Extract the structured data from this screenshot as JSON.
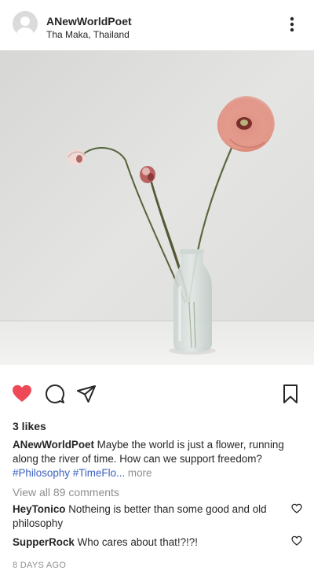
{
  "post": {
    "username": "ANewWorldPoet",
    "location": "Tha Maka, Thailand",
    "likes": "3 likes",
    "caption": {
      "author": "ANewWorldPoet",
      "text": "Maybe the world is just a flower, running along the river of time. How can we support freedom?",
      "tag1": "#Philosophy",
      "tag2": "#TimeFlo...",
      "more": "more"
    },
    "view_all": "View all 89 comments",
    "comments": [
      {
        "author": "HeyTonico",
        "text": "Notheing is better than some good and old philosophy"
      },
      {
        "author": "SupperRock",
        "text": "Who cares about that!?!?!"
      }
    ],
    "timestamp": "8 DAYS AGO"
  },
  "icons": {
    "like": "heart-filled-icon",
    "comment": "comment-bubble-icon",
    "share": "paper-plane-icon",
    "save": "bookmark-icon",
    "more": "more-vertical-icon"
  },
  "colors": {
    "like_red": "#ed4956",
    "hashtag_blue": "#3a5fbf",
    "muted_gray": "#8e8e8e"
  }
}
